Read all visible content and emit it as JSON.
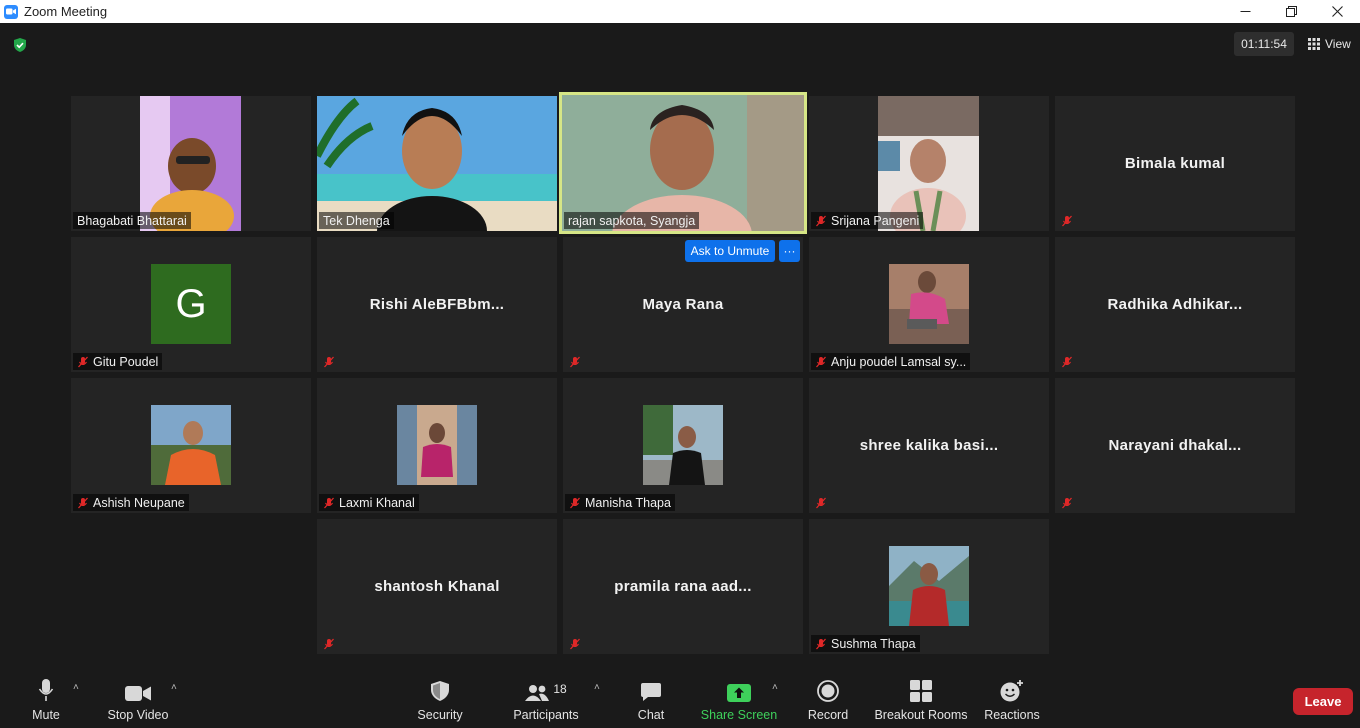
{
  "window": {
    "title": "Zoom Meeting"
  },
  "header": {
    "timer": "01:11:54",
    "view_label": "View"
  },
  "tiles": [
    {
      "name": "Bhagabati Bhattarai",
      "type": "video",
      "muted": false
    },
    {
      "name": "Tek Dhenga",
      "type": "video",
      "muted": false
    },
    {
      "name": "rajan sapkota, Syangja",
      "type": "video",
      "muted": false,
      "active_speaker": true
    },
    {
      "name": "Srijana Pangeni",
      "type": "video",
      "muted": true
    },
    {
      "name": "Bimala kumal",
      "type": "name-only",
      "muted": true
    },
    {
      "name": "Gitu Poudel",
      "type": "avatar",
      "avatar_letter": "G",
      "muted": true
    },
    {
      "name": "Rishi  AleBFBbm...",
      "type": "name-only",
      "muted": true
    },
    {
      "name": "Maya Rana",
      "type": "name-only",
      "muted": true
    },
    {
      "name": "Anju poudel Lamsal sy...",
      "type": "photo",
      "muted": true
    },
    {
      "name": "Radhika  Adhikar...",
      "type": "name-only",
      "muted": true
    },
    {
      "name": "Ashish Neupane",
      "type": "photo",
      "muted": true
    },
    {
      "name": "Laxmi Khanal",
      "type": "photo",
      "muted": true
    },
    {
      "name": "Manisha Thapa",
      "type": "photo",
      "muted": true
    },
    {
      "name": "shree kalika basi...",
      "type": "name-only",
      "muted": true
    },
    {
      "name": "Narayani  dhakal...",
      "type": "name-only",
      "muted": true
    },
    {
      "name": "shantosh Khanal",
      "type": "name-only",
      "muted": true
    },
    {
      "name": "pramila rana aad...",
      "type": "name-only",
      "muted": true
    },
    {
      "name": "Sushma Thapa",
      "type": "photo",
      "muted": true
    }
  ],
  "hover_actions": {
    "ask_to_unmute": "Ask to Unmute",
    "more": "···"
  },
  "toolbar": {
    "mute": "Mute",
    "stop_video": "Stop Video",
    "security": "Security",
    "participants": "Participants",
    "participants_count": "18",
    "chat": "Chat",
    "share_screen": "Share Screen",
    "record": "Record",
    "breakout_rooms": "Breakout Rooms",
    "reactions": "Reactions",
    "leave": "Leave"
  },
  "colors": {
    "accent_blue": "#0e71eb",
    "leave_red": "#c6242c",
    "share_green": "#3ed05b",
    "active_border": "#d6e686",
    "muted_red": "#e02828"
  }
}
